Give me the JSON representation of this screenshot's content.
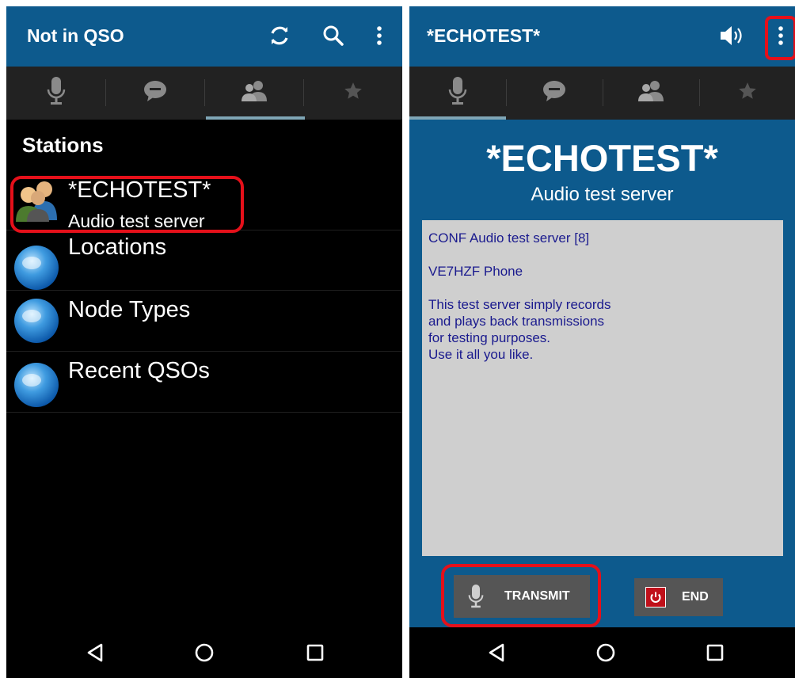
{
  "left": {
    "title": "Not in QSO",
    "list_header": "Stations",
    "items": [
      {
        "title": "*ECHOTEST*",
        "subtitle": "Audio test server",
        "icon": "people-icon"
      },
      {
        "title": "Locations",
        "icon": "globe-icon"
      },
      {
        "title": "Node Types",
        "icon": "globe-icon"
      },
      {
        "title": "Recent QSOs",
        "icon": "globe-icon"
      }
    ]
  },
  "right": {
    "title": "*ECHOTEST*",
    "station_name": "*ECHOTEST*",
    "station_desc": "Audio test server",
    "info_lines": [
      "CONF Audio test server [8]",
      "",
      "VE7HZF Phone",
      "",
      "This test server simply records",
      "and plays back transmissions",
      "for testing purposes.",
      "Use it all you like."
    ],
    "transmit_label": "TRANSMIT",
    "end_label": "END"
  },
  "colors": {
    "primary": "#0d5a8d",
    "highlight": "#e5101a",
    "tab_indicator": "#7fa6b6",
    "info_text": "#1a1a8e",
    "end_red": "#c0101a"
  }
}
